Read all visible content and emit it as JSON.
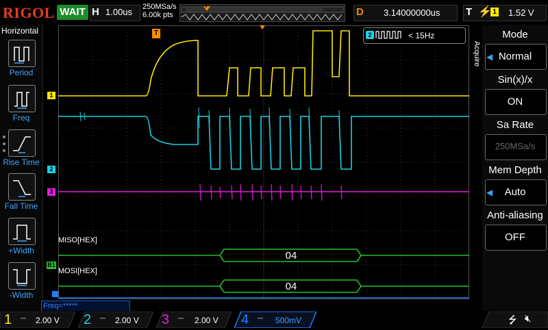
{
  "header": {
    "brand": "RIGOL",
    "run_status": "WAIT",
    "horizontal_label": "H",
    "timebase": "1.00us",
    "sample_rate": "250MSa/s",
    "memory_depth": "6.00k pts",
    "trigger_marker": "T",
    "delay_label": "D",
    "delay_value": "3.14000000us",
    "trigger_label": "T",
    "trigger_source": "1",
    "trigger_level": "1.52 V"
  },
  "left_menu": {
    "title": "Horizontal",
    "items": [
      {
        "label": "Period",
        "icon": "period-icon"
      },
      {
        "label": "Freq",
        "icon": "freq-icon"
      },
      {
        "label": "Rise Time",
        "icon": "rise-time-icon"
      },
      {
        "label": "Fall Time",
        "icon": "fall-time-icon"
      },
      {
        "label": "+Width",
        "icon": "positive-width-icon"
      },
      {
        "label": "-Width",
        "icon": "negative-width-icon"
      }
    ]
  },
  "screen": {
    "measure_readout_ch": "2",
    "measure_readout": "< 15Hz",
    "ch_markers": [
      "1",
      "2",
      "3"
    ],
    "bus_marker": "B1",
    "miso_label": "MISO[HEX]",
    "mosi_label": "MOSI[HEX]",
    "miso_value": "04",
    "mosi_value": "04",
    "freq_counter": "Freq=*****"
  },
  "right_menu": {
    "side_label": "Acquire",
    "items": [
      {
        "title": "Mode",
        "value": "Normal",
        "has_arrow": true,
        "enabled": true
      },
      {
        "title": "Sin(x)/x",
        "value": "ON",
        "has_arrow": false,
        "enabled": true
      },
      {
        "title": "Sa Rate",
        "value": "250MSa/s",
        "has_arrow": false,
        "enabled": false
      },
      {
        "title": "Mem Depth",
        "value": "Auto",
        "has_arrow": true,
        "enabled": true
      },
      {
        "title": "Anti-aliasing",
        "value": "OFF",
        "has_arrow": false,
        "enabled": true
      }
    ]
  },
  "channels": [
    {
      "num": "1",
      "scale": "2.00 V",
      "color": "#ffea00"
    },
    {
      "num": "2",
      "scale": "2.00 V",
      "color": "#19d3e6"
    },
    {
      "num": "3",
      "scale": "2.00 V",
      "color": "#e81ce0"
    },
    {
      "num": "4",
      "scale": "500mV",
      "color": "#1e7cff"
    }
  ],
  "colors": {
    "ch1": "#ffea00",
    "ch2": "#19d3e6",
    "ch3": "#e81ce0",
    "ch4": "#1e7cff",
    "bus": "#22c12a",
    "accent": "#3ba3ff",
    "trigger": "#ff8a00"
  }
}
